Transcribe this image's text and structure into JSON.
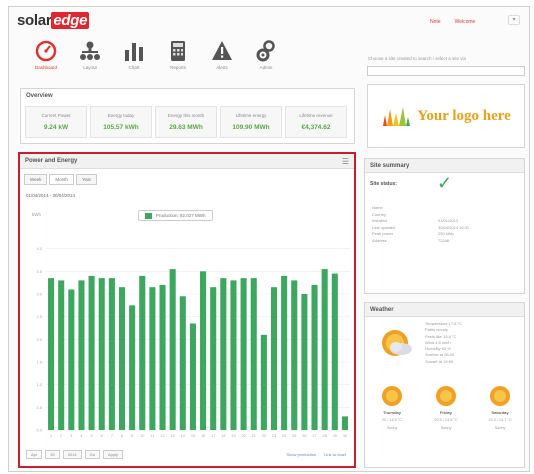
{
  "header": {
    "brand_prefix": "solar",
    "brand_suffix": "edge",
    "links": [
      "Note",
      "Welcome"
    ],
    "menu_symbol": "▾"
  },
  "nav": [
    {
      "label": "Dashboard",
      "icon": "dashboard-gauge-icon",
      "active": true
    },
    {
      "label": "Layout",
      "icon": "layout-hierarchy-icon",
      "active": false
    },
    {
      "label": "Chart",
      "icon": "chart-bars-icon",
      "active": false
    },
    {
      "label": "Reports",
      "icon": "reports-calculator-icon",
      "active": false
    },
    {
      "label": "Alerts",
      "icon": "alert-triangle-icon",
      "active": false
    },
    {
      "label": "Admin",
      "icon": "admin-gears-icon",
      "active": false
    }
  ],
  "search": {
    "hint": "Choose a site created to search / select a site via"
  },
  "overview": {
    "title": "Overview",
    "kpis": [
      {
        "label": "Current Power",
        "value": "9.24 kW"
      },
      {
        "label": "Energy today",
        "value": "105.57 kWh"
      },
      {
        "label": "Energy this month",
        "value": "29.63 MWh"
      },
      {
        "label": "Lifetime energy",
        "value": "109.90 MWh"
      },
      {
        "label": "Lifetime revenue",
        "value": "€4,374.62"
      }
    ]
  },
  "custom_logo": {
    "text": "Your logo here"
  },
  "power_energy": {
    "title": "Power and Energy",
    "tabs": [
      "Week",
      "Month",
      "Year"
    ],
    "active_tab": 1,
    "date_range": "01/04/2014 - 30/04/2014",
    "legend": "Production: 82.027 MWh",
    "unit": "kWh",
    "footer_controls": [
      "Apr",
      "30",
      "2014",
      "Go",
      "Apply"
    ],
    "footer_links": [
      "Show production",
      "Link to chart"
    ]
  },
  "chart_data": {
    "type": "bar",
    "categories": [
      "1",
      "2",
      "3",
      "4",
      "5",
      "6",
      "7",
      "8",
      "9",
      "10",
      "11",
      "12",
      "13",
      "14",
      "15",
      "16",
      "17",
      "18",
      "19",
      "20",
      "21",
      "22",
      "23",
      "24",
      "25",
      "26",
      "27",
      "28",
      "29",
      "30"
    ],
    "series": [
      {
        "name": "Production",
        "values": [
          3.35,
          3.3,
          3.1,
          3.3,
          3.4,
          3.35,
          3.35,
          3.15,
          2.75,
          3.4,
          3.15,
          3.2,
          3.55,
          2.95,
          2.35,
          3.5,
          3.15,
          3.35,
          3.3,
          3.35,
          3.35,
          2.1,
          3.15,
          3.4,
          3.3,
          3.0,
          3.2,
          3.55,
          3.45,
          0.3
        ]
      }
    ],
    "ylim": [
      0,
      4.5
    ],
    "yticks": [
      "0.0",
      "0.5",
      "1.0",
      "1.5",
      "2.0",
      "2.5",
      "3.0",
      "3.5",
      "4.0"
    ],
    "bar_color": "#3da760",
    "grid": true
  },
  "site_summary": {
    "title": "Site summary",
    "status_label": "Site status:",
    "rows": [
      {
        "k": "Name",
        "v": ""
      },
      {
        "k": "Country",
        "v": ""
      },
      {
        "k": "Installed",
        "v": "01/01/2013"
      },
      {
        "k": "Last updated",
        "v": "30/04/2014 16:41"
      },
      {
        "k": "Peak power",
        "v": "250 kWp"
      },
      {
        "k": "Address",
        "v": "72246"
      }
    ]
  },
  "weather": {
    "title": "Weather",
    "details": [
      "Temperature 17.8 °C",
      "Partly cloudy",
      "Feels like 15.8 °C",
      "Wind 4.8 km/h",
      "Humidity 63 %",
      "Sunrise at 06:29",
      "Sunset at 19:59"
    ],
    "forecast": [
      {
        "day": "Thursday",
        "range": "20 / 14.5 °C",
        "cond": "Sunny"
      },
      {
        "day": "Friday",
        "range": "20.5 / 13.9 °C",
        "cond": "Sunny"
      },
      {
        "day": "Saturday",
        "range": "19.3 / 13.7 °C",
        "cond": "Sunny"
      }
    ]
  }
}
